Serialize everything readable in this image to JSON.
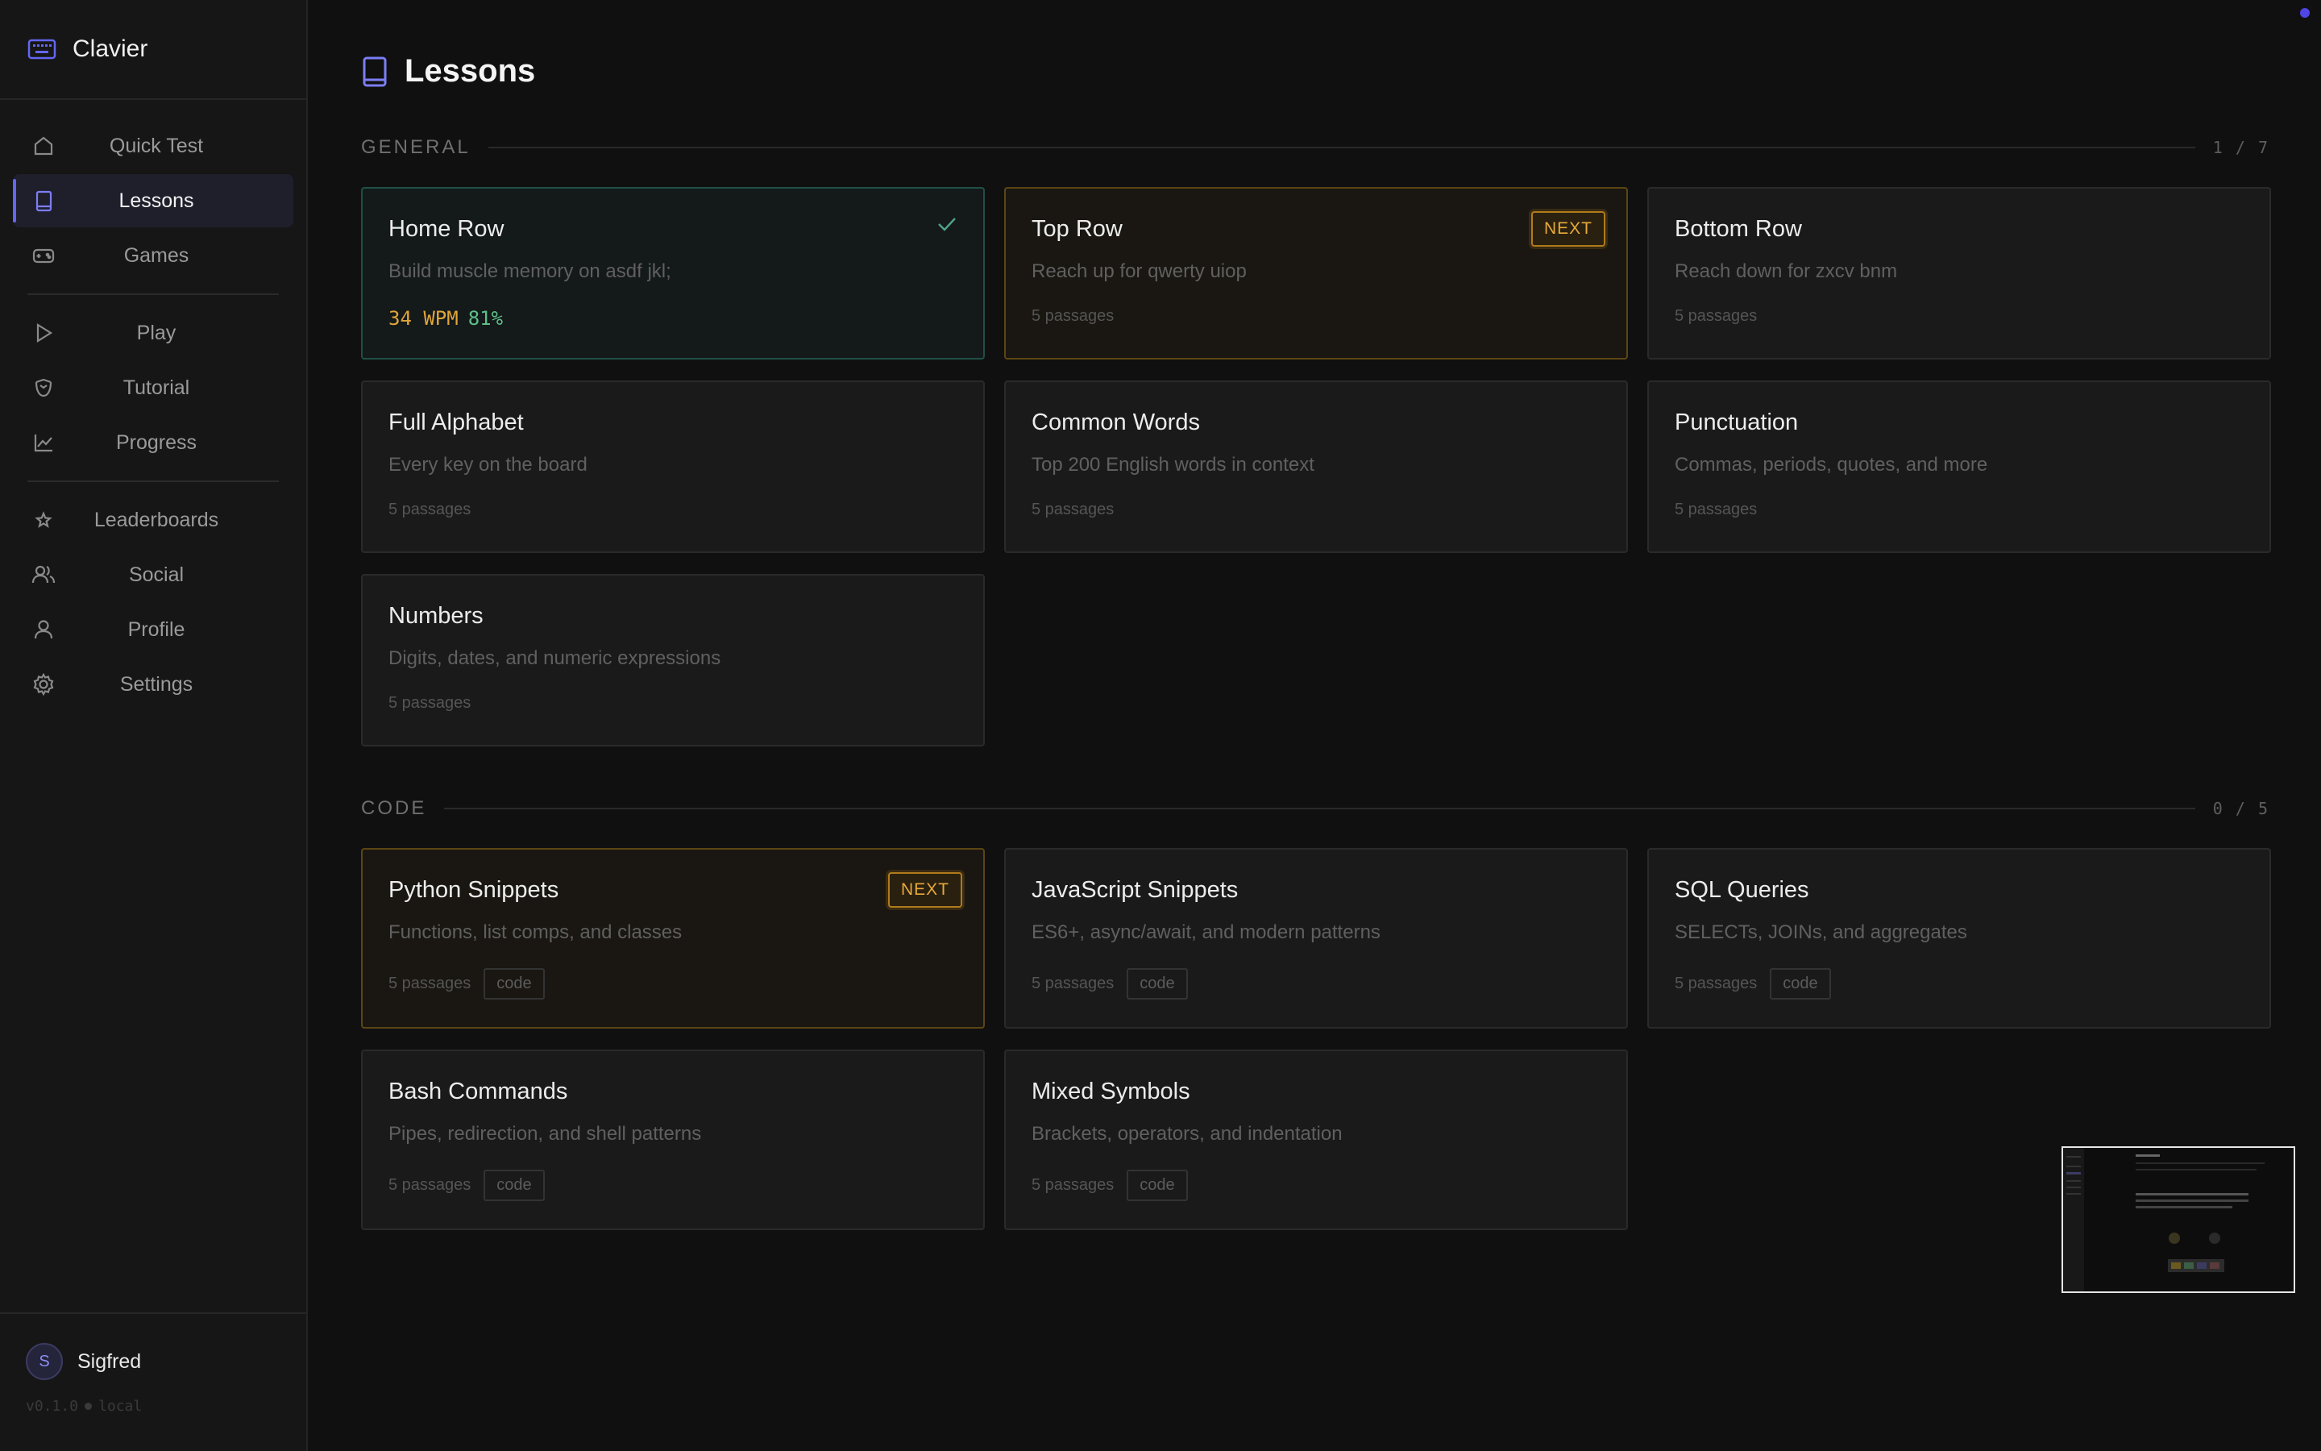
{
  "app": {
    "name": "Clavier"
  },
  "sidebar": {
    "nav_primary": [
      {
        "label": "Quick Test",
        "icon": "home-icon"
      },
      {
        "label": "Lessons",
        "icon": "book-icon",
        "active": true
      },
      {
        "label": "Games",
        "icon": "gamepad-icon"
      }
    ],
    "nav_secondary": [
      {
        "label": "Play",
        "icon": "play-icon"
      },
      {
        "label": "Tutorial",
        "icon": "graduation-icon"
      },
      {
        "label": "Progress",
        "icon": "chart-icon"
      }
    ],
    "nav_tertiary": [
      {
        "label": "Leaderboards",
        "icon": "star-icon"
      },
      {
        "label": "Social",
        "icon": "users-icon"
      },
      {
        "label": "Profile",
        "icon": "user-icon"
      },
      {
        "label": "Settings",
        "icon": "gear-icon"
      }
    ],
    "user": {
      "initial": "S",
      "name": "Sigfred"
    },
    "version": {
      "number": "v0.1.0",
      "mode": "local"
    }
  },
  "page": {
    "title": "Lessons"
  },
  "sections": {
    "general": {
      "name": "GENERAL",
      "count": "1 / 7",
      "cards": [
        {
          "title": "Home Row",
          "desc": "Build muscle memory on asdf jkl;",
          "status": "done",
          "wpm": "34 WPM",
          "accuracy": "81%"
        },
        {
          "title": "Top Row",
          "desc": "Reach up for qwerty uiop",
          "status": "next",
          "badge": "NEXT",
          "meta": "5 passages"
        },
        {
          "title": "Bottom Row",
          "desc": "Reach down for zxcv bnm",
          "meta": "5 passages"
        },
        {
          "title": "Full Alphabet",
          "desc": "Every key on the board",
          "meta": "5 passages"
        },
        {
          "title": "Common Words",
          "desc": "Top 200 English words in context",
          "meta": "5 passages"
        },
        {
          "title": "Punctuation",
          "desc": "Commas, periods, quotes, and more",
          "meta": "5 passages"
        },
        {
          "title": "Numbers",
          "desc": "Digits, dates, and numeric expressions",
          "meta": "5 passages"
        }
      ]
    },
    "code": {
      "name": "CODE",
      "count": "0 / 5",
      "cards": [
        {
          "title": "Python Snippets",
          "desc": "Functions, list comps, and classes",
          "status": "next",
          "badge": "NEXT",
          "meta": "5 passages",
          "tag": "code"
        },
        {
          "title": "JavaScript Snippets",
          "desc": "ES6+, async/await, and modern patterns",
          "meta": "5 passages",
          "tag": "code"
        },
        {
          "title": "SQL Queries",
          "desc": "SELECTs, JOINs, and aggregates",
          "meta": "5 passages",
          "tag": "code"
        },
        {
          "title": "Bash Commands",
          "desc": "Pipes, redirection, and shell patterns",
          "meta": "5 passages",
          "tag": "code"
        },
        {
          "title": "Mixed Symbols",
          "desc": "Brackets, operators, and indentation",
          "meta": "5 passages",
          "tag": "code"
        }
      ]
    }
  },
  "colors": {
    "accent": "#6366f1",
    "next": "#e7a93c",
    "done": "#5fbf8a",
    "wpm": "#e0a53a"
  }
}
